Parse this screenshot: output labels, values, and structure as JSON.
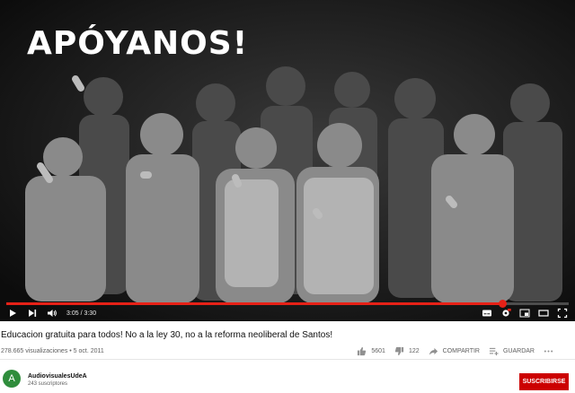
{
  "player": {
    "overlay_text": "APÓYANOS!",
    "current_time": "3:05",
    "duration": "3:30",
    "time_display": "3:05 / 3:30",
    "progress_fraction": 0.881,
    "accent_color": "#e62117",
    "controls_left": [
      "play-icon",
      "next-icon",
      "volume-icon"
    ],
    "controls_right": [
      "subtitles-icon",
      "settings-icon",
      "miniplayer-icon",
      "theater-icon",
      "fullscreen-icon"
    ]
  },
  "video": {
    "title": "Educacion gratuita para todos! No a la ley 30, no a la reforma neoliberal de Santos!",
    "views": "278.665 visualizaciones",
    "date": "5 oct. 2011",
    "meta": "278.665 visualizaciones • 5 oct. 2011"
  },
  "actions": {
    "likes": "5601",
    "dislikes": "122",
    "share_label": "COMPARTIR",
    "save_label": "GUARDAR",
    "icons": [
      "thumbs-up-icon",
      "thumbs-down-icon",
      "share-icon",
      "save-playlist-icon",
      "more-icon"
    ]
  },
  "channel": {
    "avatar_letter": "A",
    "name": "AudiovisualesUdeA",
    "subscribers": "243 suscriptores",
    "subscribe_label": "SUSCRIBIRSE",
    "avatar_color": "#2f8d3c",
    "subscribe_color": "#cc0000"
  }
}
